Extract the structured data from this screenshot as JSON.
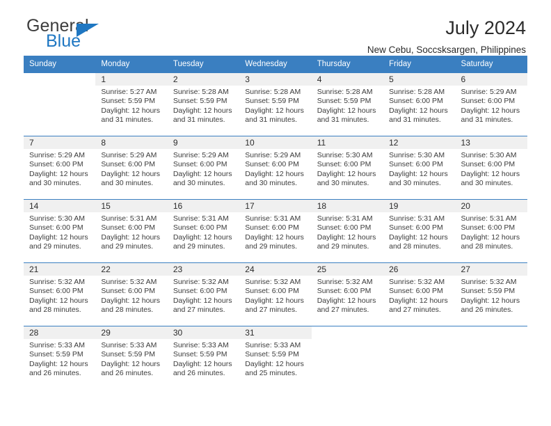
{
  "brand": {
    "name_top": "General",
    "name_bottom": "Blue",
    "triangle_color": "#1f77c2",
    "text_color": "#3c3c3c"
  },
  "header": {
    "title": "July 2024",
    "subtitle": "New Cebu, Soccsksargen, Philippines"
  },
  "theme": {
    "header_blue": "#3a7fc1",
    "daynum_band": "#f0f0f0",
    "text": "#3b3b3b"
  },
  "weekdays": [
    "Sunday",
    "Monday",
    "Tuesday",
    "Wednesday",
    "Thursday",
    "Friday",
    "Saturday"
  ],
  "weeks": [
    [
      {
        "day": "",
        "sunrise": "",
        "sunset": "",
        "daylight": "",
        "blank": true
      },
      {
        "day": "1",
        "sunrise": "Sunrise: 5:27 AM",
        "sunset": "Sunset: 5:59 PM",
        "daylight": "Daylight: 12 hours and 31 minutes."
      },
      {
        "day": "2",
        "sunrise": "Sunrise: 5:28 AM",
        "sunset": "Sunset: 5:59 PM",
        "daylight": "Daylight: 12 hours and 31 minutes."
      },
      {
        "day": "3",
        "sunrise": "Sunrise: 5:28 AM",
        "sunset": "Sunset: 5:59 PM",
        "daylight": "Daylight: 12 hours and 31 minutes."
      },
      {
        "day": "4",
        "sunrise": "Sunrise: 5:28 AM",
        "sunset": "Sunset: 5:59 PM",
        "daylight": "Daylight: 12 hours and 31 minutes."
      },
      {
        "day": "5",
        "sunrise": "Sunrise: 5:28 AM",
        "sunset": "Sunset: 6:00 PM",
        "daylight": "Daylight: 12 hours and 31 minutes."
      },
      {
        "day": "6",
        "sunrise": "Sunrise: 5:29 AM",
        "sunset": "Sunset: 6:00 PM",
        "daylight": "Daylight: 12 hours and 31 minutes."
      }
    ],
    [
      {
        "day": "7",
        "sunrise": "Sunrise: 5:29 AM",
        "sunset": "Sunset: 6:00 PM",
        "daylight": "Daylight: 12 hours and 30 minutes."
      },
      {
        "day": "8",
        "sunrise": "Sunrise: 5:29 AM",
        "sunset": "Sunset: 6:00 PM",
        "daylight": "Daylight: 12 hours and 30 minutes."
      },
      {
        "day": "9",
        "sunrise": "Sunrise: 5:29 AM",
        "sunset": "Sunset: 6:00 PM",
        "daylight": "Daylight: 12 hours and 30 minutes."
      },
      {
        "day": "10",
        "sunrise": "Sunrise: 5:29 AM",
        "sunset": "Sunset: 6:00 PM",
        "daylight": "Daylight: 12 hours and 30 minutes."
      },
      {
        "day": "11",
        "sunrise": "Sunrise: 5:30 AM",
        "sunset": "Sunset: 6:00 PM",
        "daylight": "Daylight: 12 hours and 30 minutes."
      },
      {
        "day": "12",
        "sunrise": "Sunrise: 5:30 AM",
        "sunset": "Sunset: 6:00 PM",
        "daylight": "Daylight: 12 hours and 30 minutes."
      },
      {
        "day": "13",
        "sunrise": "Sunrise: 5:30 AM",
        "sunset": "Sunset: 6:00 PM",
        "daylight": "Daylight: 12 hours and 30 minutes."
      }
    ],
    [
      {
        "day": "14",
        "sunrise": "Sunrise: 5:30 AM",
        "sunset": "Sunset: 6:00 PM",
        "daylight": "Daylight: 12 hours and 29 minutes."
      },
      {
        "day": "15",
        "sunrise": "Sunrise: 5:31 AM",
        "sunset": "Sunset: 6:00 PM",
        "daylight": "Daylight: 12 hours and 29 minutes."
      },
      {
        "day": "16",
        "sunrise": "Sunrise: 5:31 AM",
        "sunset": "Sunset: 6:00 PM",
        "daylight": "Daylight: 12 hours and 29 minutes."
      },
      {
        "day": "17",
        "sunrise": "Sunrise: 5:31 AM",
        "sunset": "Sunset: 6:00 PM",
        "daylight": "Daylight: 12 hours and 29 minutes."
      },
      {
        "day": "18",
        "sunrise": "Sunrise: 5:31 AM",
        "sunset": "Sunset: 6:00 PM",
        "daylight": "Daylight: 12 hours and 29 minutes."
      },
      {
        "day": "19",
        "sunrise": "Sunrise: 5:31 AM",
        "sunset": "Sunset: 6:00 PM",
        "daylight": "Daylight: 12 hours and 28 minutes."
      },
      {
        "day": "20",
        "sunrise": "Sunrise: 5:31 AM",
        "sunset": "Sunset: 6:00 PM",
        "daylight": "Daylight: 12 hours and 28 minutes."
      }
    ],
    [
      {
        "day": "21",
        "sunrise": "Sunrise: 5:32 AM",
        "sunset": "Sunset: 6:00 PM",
        "daylight": "Daylight: 12 hours and 28 minutes."
      },
      {
        "day": "22",
        "sunrise": "Sunrise: 5:32 AM",
        "sunset": "Sunset: 6:00 PM",
        "daylight": "Daylight: 12 hours and 28 minutes."
      },
      {
        "day": "23",
        "sunrise": "Sunrise: 5:32 AM",
        "sunset": "Sunset: 6:00 PM",
        "daylight": "Daylight: 12 hours and 27 minutes."
      },
      {
        "day": "24",
        "sunrise": "Sunrise: 5:32 AM",
        "sunset": "Sunset: 6:00 PM",
        "daylight": "Daylight: 12 hours and 27 minutes."
      },
      {
        "day": "25",
        "sunrise": "Sunrise: 5:32 AM",
        "sunset": "Sunset: 6:00 PM",
        "daylight": "Daylight: 12 hours and 27 minutes."
      },
      {
        "day": "26",
        "sunrise": "Sunrise: 5:32 AM",
        "sunset": "Sunset: 6:00 PM",
        "daylight": "Daylight: 12 hours and 27 minutes."
      },
      {
        "day": "27",
        "sunrise": "Sunrise: 5:32 AM",
        "sunset": "Sunset: 5:59 PM",
        "daylight": "Daylight: 12 hours and 26 minutes."
      }
    ],
    [
      {
        "day": "28",
        "sunrise": "Sunrise: 5:33 AM",
        "sunset": "Sunset: 5:59 PM",
        "daylight": "Daylight: 12 hours and 26 minutes."
      },
      {
        "day": "29",
        "sunrise": "Sunrise: 5:33 AM",
        "sunset": "Sunset: 5:59 PM",
        "daylight": "Daylight: 12 hours and 26 minutes."
      },
      {
        "day": "30",
        "sunrise": "Sunrise: 5:33 AM",
        "sunset": "Sunset: 5:59 PM",
        "daylight": "Daylight: 12 hours and 26 minutes."
      },
      {
        "day": "31",
        "sunrise": "Sunrise: 5:33 AM",
        "sunset": "Sunset: 5:59 PM",
        "daylight": "Daylight: 12 hours and 25 minutes."
      },
      {
        "day": "",
        "sunrise": "",
        "sunset": "",
        "daylight": "",
        "blank": true
      },
      {
        "day": "",
        "sunrise": "",
        "sunset": "",
        "daylight": "",
        "blank": true
      },
      {
        "day": "",
        "sunrise": "",
        "sunset": "",
        "daylight": "",
        "blank": true
      }
    ]
  ]
}
